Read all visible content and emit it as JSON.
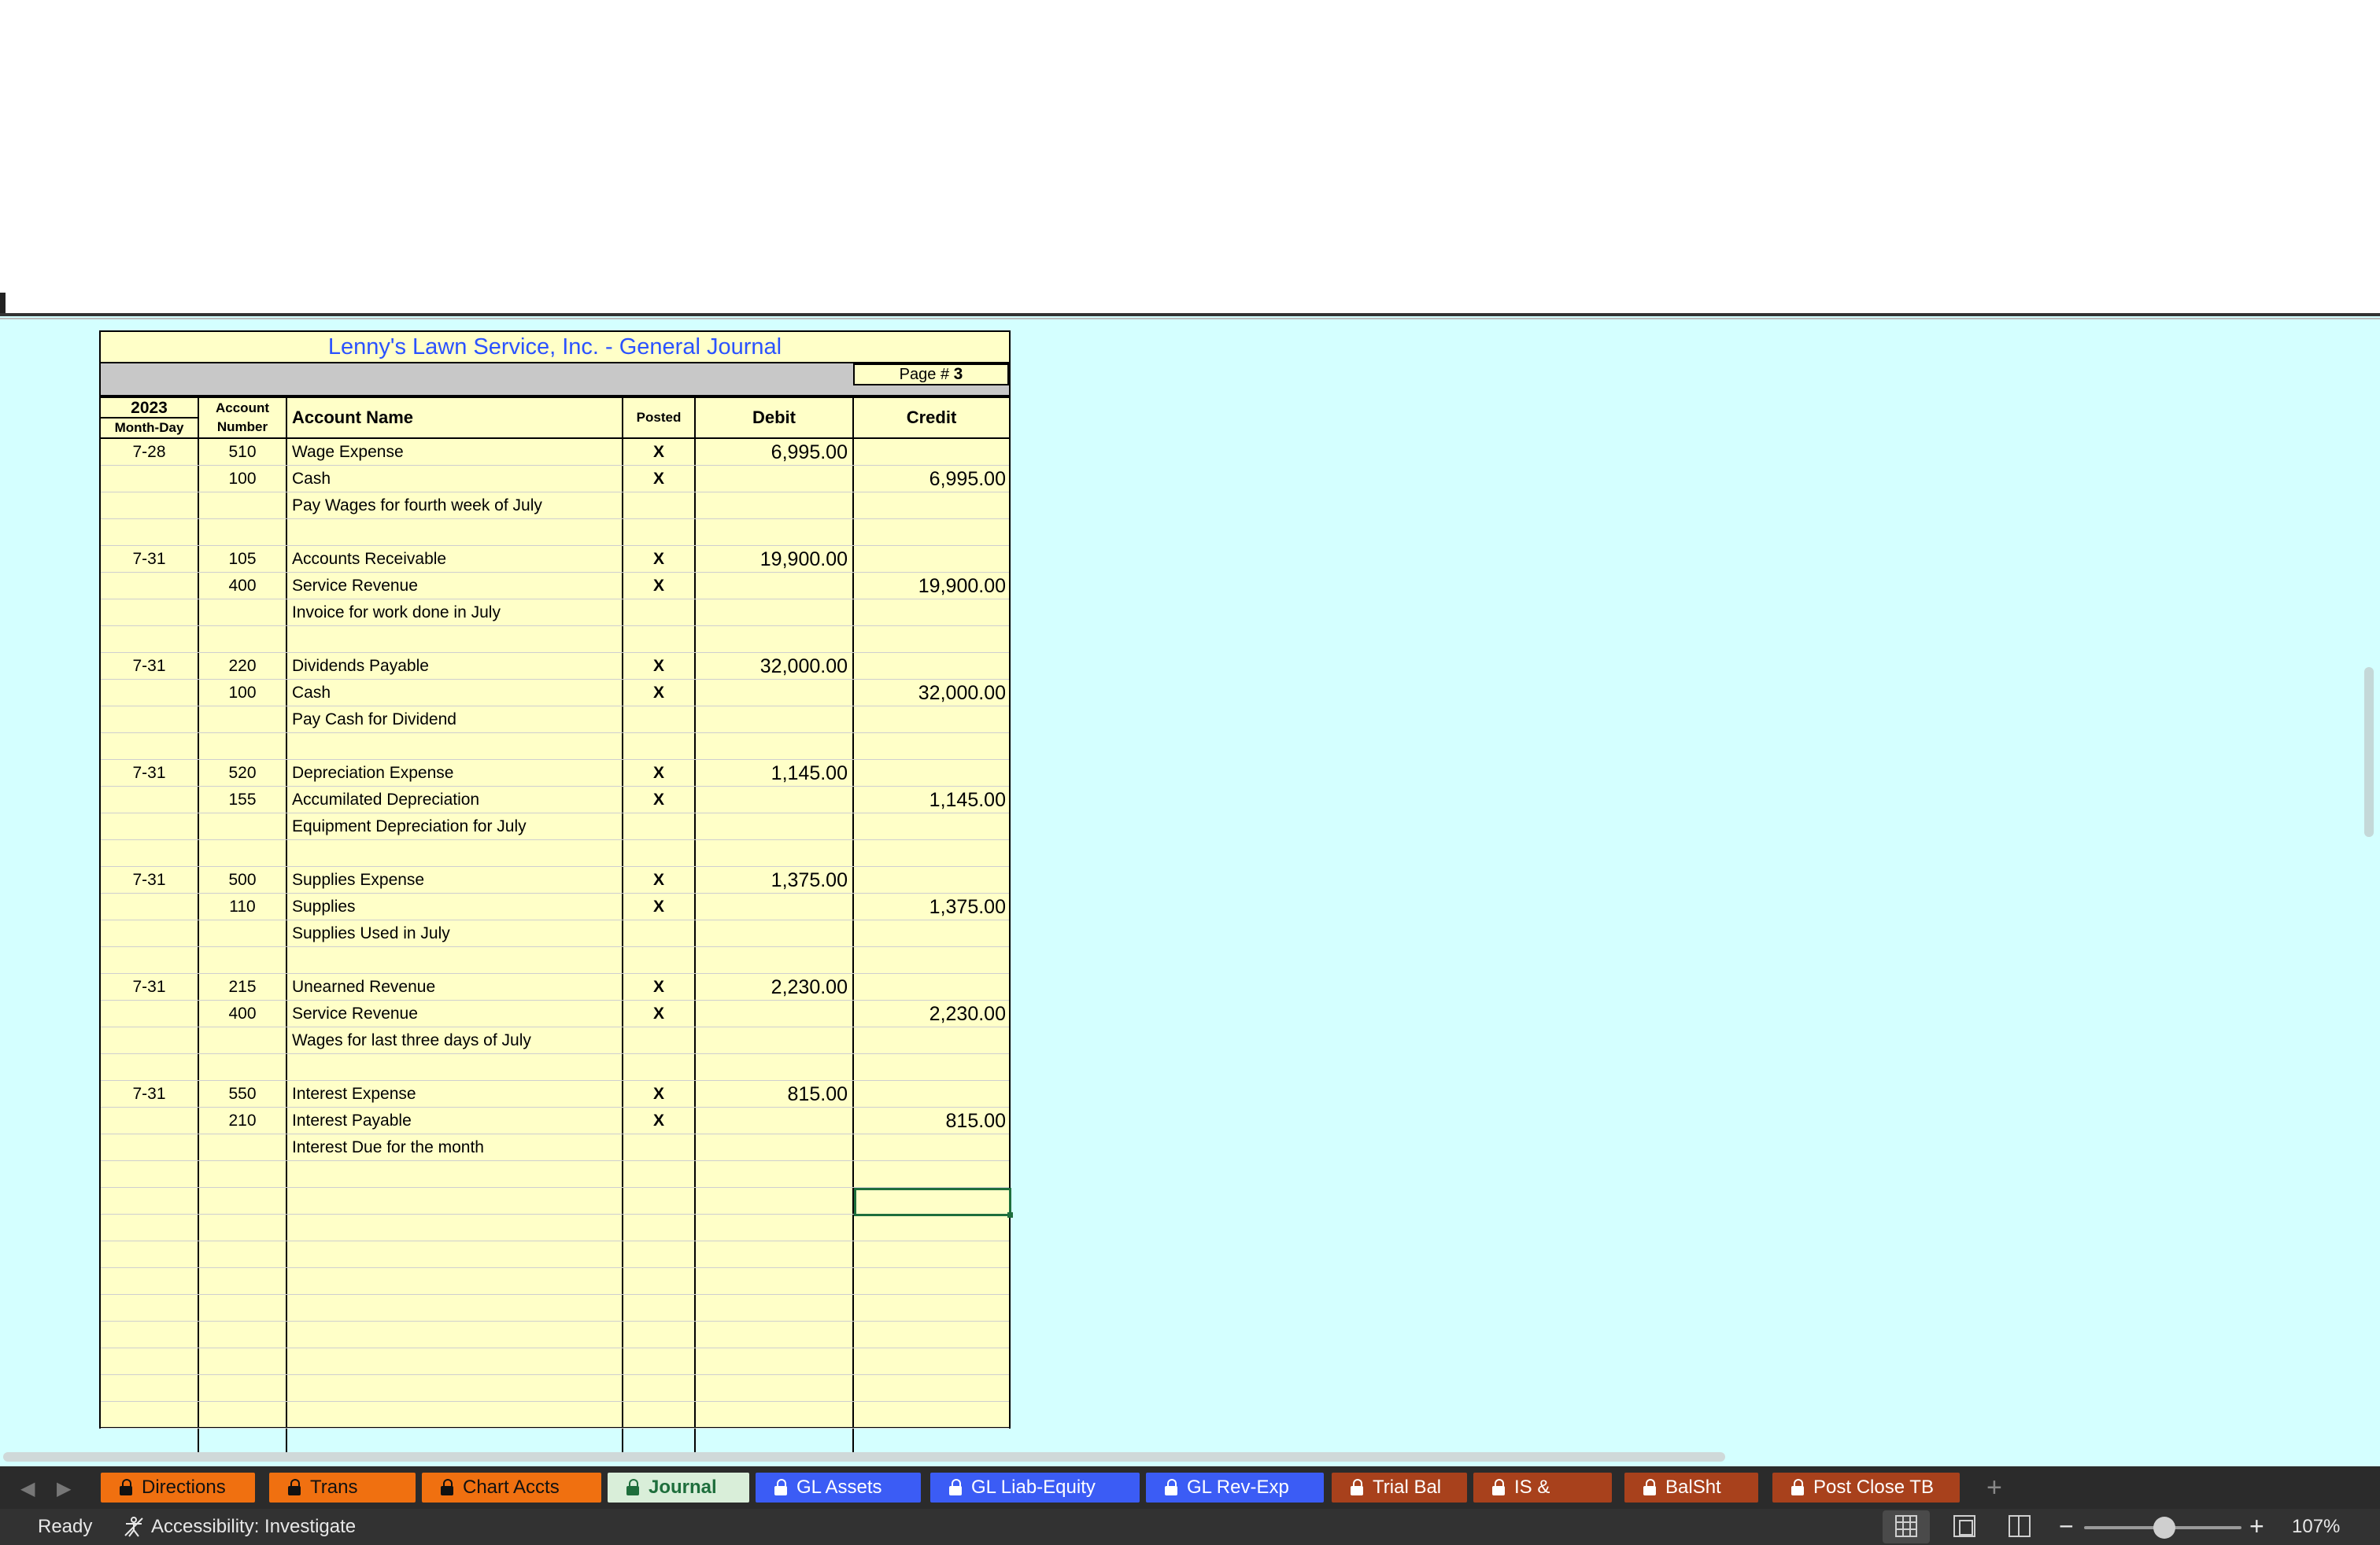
{
  "journal": {
    "title": "Lenny's Lawn Service, Inc.  -  General Journal",
    "page_label": "Page # ",
    "page_number": "3",
    "headers": {
      "year": "2023",
      "month_day": "Month-Day",
      "account_number": "Account Number",
      "account_name": "Account Name",
      "posted": "Posted",
      "debit": "Debit",
      "credit": "Credit"
    },
    "rows": [
      {
        "date": "7-28",
        "acct": "510",
        "name": "Wage Expense",
        "posted": "X",
        "debit": "6,995.00",
        "credit": ""
      },
      {
        "date": "",
        "acct": "100",
        "name": "Cash",
        "posted": "X",
        "debit": "",
        "credit": "6,995.00"
      },
      {
        "date": "",
        "acct": "",
        "name": "Pay Wages for fourth week of July",
        "posted": "",
        "debit": "",
        "credit": ""
      },
      {
        "date": "",
        "acct": "",
        "name": "",
        "posted": "",
        "debit": "",
        "credit": ""
      },
      {
        "date": "7-31",
        "acct": "105",
        "name": "Accounts Receivable",
        "posted": "X",
        "debit": "19,900.00",
        "credit": ""
      },
      {
        "date": "",
        "acct": "400",
        "name": "Service Revenue",
        "posted": "X",
        "debit": "",
        "credit": "19,900.00"
      },
      {
        "date": "",
        "acct": "",
        "name": "Invoice for work done in July",
        "posted": "",
        "debit": "",
        "credit": ""
      },
      {
        "date": "",
        "acct": "",
        "name": "",
        "posted": "",
        "debit": "",
        "credit": ""
      },
      {
        "date": "7-31",
        "acct": "220",
        "name": "Dividends Payable",
        "posted": "X",
        "debit": "32,000.00",
        "credit": ""
      },
      {
        "date": "",
        "acct": "100",
        "name": "Cash",
        "posted": "X",
        "debit": "",
        "credit": "32,000.00"
      },
      {
        "date": "",
        "acct": "",
        "name": "Pay Cash for Dividend",
        "posted": "",
        "debit": "",
        "credit": ""
      },
      {
        "date": "",
        "acct": "",
        "name": "",
        "posted": "",
        "debit": "",
        "credit": ""
      },
      {
        "date": "7-31",
        "acct": "520",
        "name": "Depreciation Expense",
        "posted": "X",
        "debit": "1,145.00",
        "credit": ""
      },
      {
        "date": "",
        "acct": "155",
        "name": "Accumilated Depreciation",
        "posted": "X",
        "debit": "",
        "credit": "1,145.00"
      },
      {
        "date": "",
        "acct": "",
        "name": "Equipment Depreciation for July",
        "posted": "",
        "debit": "",
        "credit": ""
      },
      {
        "date": "",
        "acct": "",
        "name": "",
        "posted": "",
        "debit": "",
        "credit": ""
      },
      {
        "date": "7-31",
        "acct": "500",
        "name": "Supplies Expense",
        "posted": "X",
        "debit": "1,375.00",
        "credit": ""
      },
      {
        "date": "",
        "acct": "110",
        "name": "Supplies",
        "posted": "X",
        "debit": "",
        "credit": "1,375.00"
      },
      {
        "date": "",
        "acct": "",
        "name": "Supplies Used in July",
        "posted": "",
        "debit": "",
        "credit": ""
      },
      {
        "date": "",
        "acct": "",
        "name": "",
        "posted": "",
        "debit": "",
        "credit": ""
      },
      {
        "date": "7-31",
        "acct": "215",
        "name": "Unearned Revenue",
        "posted": "X",
        "debit": "2,230.00",
        "credit": ""
      },
      {
        "date": "",
        "acct": "400",
        "name": "Service Revenue",
        "posted": "X",
        "debit": "",
        "credit": "2,230.00"
      },
      {
        "date": "",
        "acct": "",
        "name": "Wages for last three days of July",
        "posted": "",
        "debit": "",
        "credit": ""
      },
      {
        "date": "",
        "acct": "",
        "name": "",
        "posted": "",
        "debit": "",
        "credit": ""
      },
      {
        "date": "7-31",
        "acct": "550",
        "name": "Interest Expense",
        "posted": "X",
        "debit": "815.00",
        "credit": ""
      },
      {
        "date": "",
        "acct": "210",
        "name": "Interest Payable",
        "posted": "X",
        "debit": "",
        "credit": "815.00"
      },
      {
        "date": "",
        "acct": "",
        "name": "Interest Due for the month",
        "posted": "",
        "debit": "",
        "credit": ""
      },
      {
        "date": "",
        "acct": "",
        "name": "",
        "posted": "",
        "debit": "",
        "credit": ""
      },
      {
        "date": "",
        "acct": "",
        "name": "",
        "posted": "",
        "debit": "",
        "credit": ""
      },
      {
        "date": "",
        "acct": "",
        "name": "",
        "posted": "",
        "debit": "",
        "credit": ""
      },
      {
        "date": "",
        "acct": "",
        "name": "",
        "posted": "",
        "debit": "",
        "credit": ""
      },
      {
        "date": "",
        "acct": "",
        "name": "",
        "posted": "",
        "debit": "",
        "credit": ""
      },
      {
        "date": "",
        "acct": "",
        "name": "",
        "posted": "",
        "debit": "",
        "credit": ""
      },
      {
        "date": "",
        "acct": "",
        "name": "",
        "posted": "",
        "debit": "",
        "credit": ""
      },
      {
        "date": "",
        "acct": "",
        "name": "",
        "posted": "",
        "debit": "",
        "credit": ""
      },
      {
        "date": "",
        "acct": "",
        "name": "",
        "posted": "",
        "debit": "",
        "credit": ""
      },
      {
        "date": "",
        "acct": "",
        "name": "",
        "posted": "",
        "debit": "",
        "credit": ""
      },
      {
        "date": "",
        "acct": "",
        "name": "",
        "posted": "",
        "debit": "",
        "credit": ""
      }
    ]
  },
  "sheet_tabs": [
    {
      "label": "Directions",
      "locked": true,
      "color": "orange"
    },
    {
      "label": "Trans",
      "locked": true,
      "color": "orange"
    },
    {
      "label": "Chart Accts",
      "locked": true,
      "color": "orange"
    },
    {
      "label": "Journal",
      "locked": true,
      "color": "active"
    },
    {
      "label": "GL Assets",
      "locked": true,
      "color": "blue"
    },
    {
      "label": "GL Liab-Equity",
      "locked": true,
      "color": "blue"
    },
    {
      "label": "GL Rev-Exp",
      "locked": true,
      "color": "blue"
    },
    {
      "label": "Trial Bal",
      "locked": true,
      "color": "brown"
    },
    {
      "label": "IS & SEquity",
      "locked": true,
      "color": "brown"
    },
    {
      "label": "BalSht",
      "locked": true,
      "color": "brown"
    },
    {
      "label": "Post Close TB",
      "locked": true,
      "color": "brown"
    }
  ],
  "status": {
    "ready": "Ready",
    "accessibility": "Accessibility: Investigate",
    "zoom": "107%",
    "zoom_minus": "−",
    "zoom_plus": "+"
  },
  "icons": {
    "nav_prev": "triangle-left-icon",
    "nav_next": "triangle-right-icon",
    "add_sheet": "plus-icon",
    "lock": "lock-icon",
    "accessibility": "accessibility-icon"
  }
}
